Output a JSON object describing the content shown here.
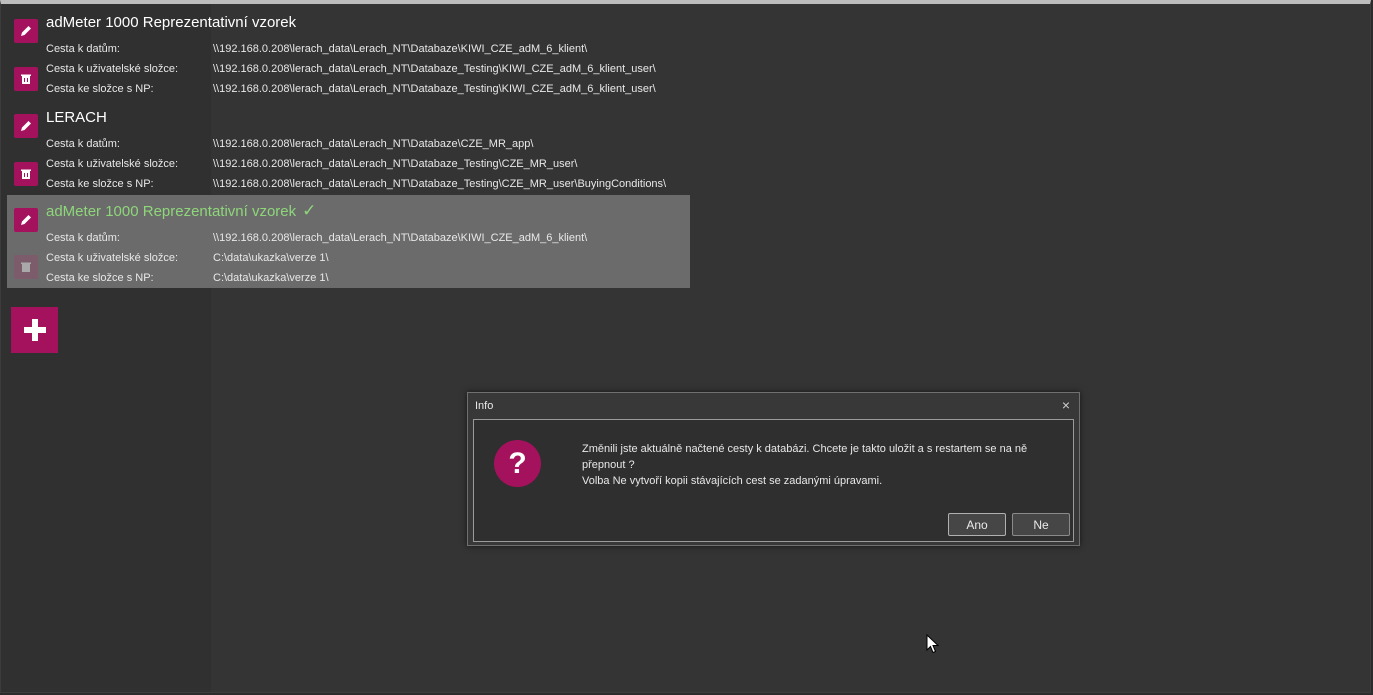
{
  "databases": [
    {
      "name": "adMeter 1000 Reprezentativní vzorek",
      "selected": false,
      "rows": [
        {
          "label": "Cesta k datům:",
          "value": "\\\\192.168.0.208\\lerach_data\\Lerach_NT\\Databaze\\KIWI_CZE_adM_6_klient\\"
        },
        {
          "label": "Cesta k uživatelské složce:",
          "value": "\\\\192.168.0.208\\lerach_data\\Lerach_NT\\Databaze_Testing\\KIWI_CZE_adM_6_klient_user\\"
        },
        {
          "label": "Cesta ke složce s NP:",
          "value": "\\\\192.168.0.208\\lerach_data\\Lerach_NT\\Databaze_Testing\\KIWI_CZE_adM_6_klient_user\\"
        }
      ]
    },
    {
      "name": "LERACH",
      "selected": false,
      "rows": [
        {
          "label": "Cesta k datům:",
          "value": "\\\\192.168.0.208\\lerach_data\\Lerach_NT\\Databaze\\CZE_MR_app\\"
        },
        {
          "label": "Cesta k uživatelské složce:",
          "value": "\\\\192.168.0.208\\lerach_data\\Lerach_NT\\Databaze_Testing\\CZE_MR_user\\"
        },
        {
          "label": "Cesta ke složce s NP:",
          "value": "\\\\192.168.0.208\\lerach_data\\Lerach_NT\\Databaze_Testing\\CZE_MR_user\\BuyingConditions\\"
        }
      ]
    },
    {
      "name": "adMeter 1000 Reprezentativní vzorek",
      "selected": true,
      "check": "✓",
      "rows": [
        {
          "label": "Cesta k datům:",
          "value": "\\\\192.168.0.208\\lerach_data\\Lerach_NT\\Databaze\\KIWI_CZE_adM_6_klient\\"
        },
        {
          "label": "Cesta k uživatelské složce:",
          "value": "C:\\data\\ukazka\\verze 1\\"
        },
        {
          "label": "Cesta ke složce s NP:",
          "value": "C:\\data\\ukazka\\verze 1\\"
        }
      ]
    }
  ],
  "icons": {
    "edit": "pencil-icon",
    "delete": "trash-icon",
    "add": "plus-icon",
    "dialog": "question-icon"
  },
  "colors": {
    "accent": "#a4125e",
    "selected_name": "#8ed67a",
    "selected_bg": "#6b6b6b"
  },
  "dialog": {
    "title": "Info",
    "close": "×",
    "message_line1": "Změnili jste aktuálně načtené cesty k databázi. Chcete je takto uložit a s restartem se na ně přepnout ?",
    "message_line2": "Volba Ne vytvoří kopii stávajících cest se zadanými úpravami.",
    "icon_glyph": "?",
    "yes_label": "Ano",
    "no_label": "Ne"
  }
}
